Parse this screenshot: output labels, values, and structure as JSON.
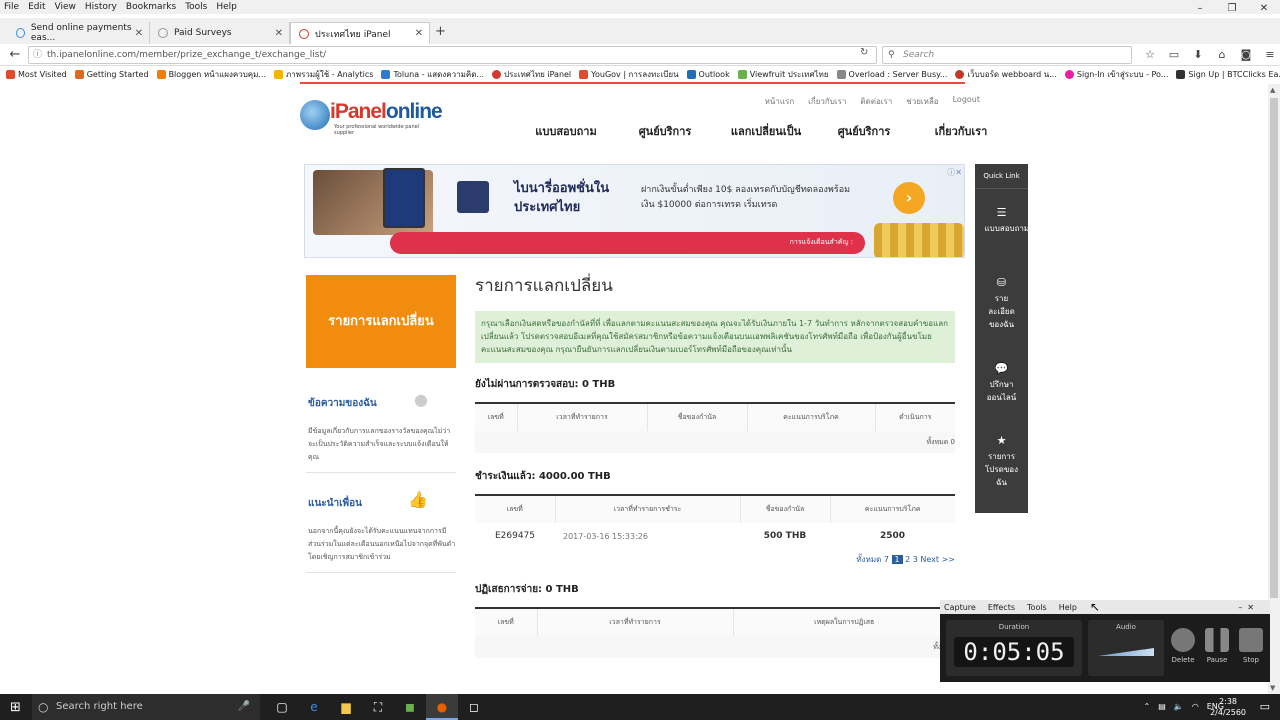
{
  "browser": {
    "menu": [
      "File",
      "Edit",
      "View",
      "History",
      "Bookmarks",
      "Tools",
      "Help"
    ],
    "tabs": [
      {
        "label": "Send online payments eas..."
      },
      {
        "label": "Paid Surveys"
      },
      {
        "label": "ประเทศไทย iPanel"
      }
    ],
    "url": "th.ipanelonline.com/member/prize_exchange_t/exchange_list/",
    "search_placeholder": "Search",
    "bookmarks": [
      "Most Visited",
      "Getting Started",
      "Bloggen หน้าแผงควบคุม...",
      "ภาพรวมผู้ใช้ - Analytics",
      "Toluna - แสดงความคิด...",
      "ประเทศไทย iPanel",
      "YouGov | การลงทะเบียน",
      "Outlook",
      "Viewfruit ประเทศไทย",
      "Overload : Server Busy...",
      "เว็บบอร์ด webboard น...",
      "Sign-In เข้าสู่ระบบ - Po...",
      "Sign Up | BTCClicks Ea..."
    ]
  },
  "site": {
    "logo_text_a": "iPanel",
    "logo_text_b": "online",
    "logo_tag": "Your professional worldwide panel supplier",
    "toplinks": [
      "หน้าแรก",
      "เกี่ยวกับเรา",
      "ติดต่อเรา",
      "ช่วยเหลือ",
      "Logout"
    ],
    "mainnav": [
      "แบบสอบถาม",
      "ศูนย์บริการ",
      "แลกเปลี่ยนเป็น",
      "ศูนย์บริการ",
      "เกี่ยวกับเรา"
    ]
  },
  "banner": {
    "headline": "ไบนารี่ออพชั่นใน ประเทศไทย",
    "sub": "ฝากเงินขั้นต่ำเพียง 10$ ลองเทรดกับบัญชีทดลองพร้อมเงิน $10000 ต่อการเทรด เริ่มเทรด",
    "redbar_text": "การแจ้งเตือนสำคัญ :"
  },
  "quicklink": {
    "title": "Quick Link",
    "items": [
      {
        "label": "แบบสอบถาม",
        "icon": "list-icon"
      },
      {
        "label": "รายละเอียดของฉัน",
        "icon": "database-icon"
      },
      {
        "label": "ปรึกษาออนไลน์",
        "icon": "chat-icon"
      },
      {
        "label": "รายการโปรดของฉัน",
        "icon": "star-icon"
      }
    ]
  },
  "sidebar": {
    "active": "รายการแลกเปลี่ยน",
    "messages_title": "ข้อความของฉัน",
    "messages_desc": "มีข้อมูลเกี่ยวกับการแลกของรางวัลของคุณไม่ว่าจะเป็นประวัติความสำเร็จและระบบแจ้งเตือนให้คุณ",
    "refer_title": "แนะนำเพื่อน",
    "refer_desc": "นอกจากนี้คุณยังจะได้รับคะแนนแทนจากการมีส่วนร่วมในแต่ละเดือนนอกเหนือไปจากจุดที่พันดำโดยเชิญการสมาชิกเข้าร่วม"
  },
  "content": {
    "title": "รายการแลกเปลี่ยน",
    "notice": "กรุณาเลือกเงินสดหรือของกำนัลที่ที่ เพื่อแลกตามคะแนนสะสมของคุณ คุณจะได้รับเงินภายใน 1-7 วันทำการ หลักจากตรวจสอบคำขอแลกเปลี่ยนแล้ว โปรดตรวจสอบอีเมลที่คุณใช้สมัครสมาชิกหรือข้อความแจ้งเตือนบนแอพพลิเคชันของโทรศัพท์มือถือ เพื่อป้องกันผู้อื่นขโมยคะแนนสะสมของคุณ กรุณายืนยันการแลกเปลี่ยนเงินตามเบอร์โทรศัพท์มือถือของคุณเท่านั้น",
    "pending": {
      "title": "ยังไม่ผ่านการตรวจสอบ: 0 THB",
      "headers": [
        "เลขที่",
        "เวลาที่ทำรายการ",
        "ชื่อของกำนัล",
        "คะแนนการบริโภค",
        "ดำเนินการ"
      ],
      "total": "ทั้งหมด 0"
    },
    "paid": {
      "title": "ชำระเงินแล้ว: 4000.00 THB",
      "headers": [
        "เลขที่",
        "เวลาที่ทำรายการชำระ",
        "ชื่อของกำนัล",
        "คะแนนการบริโภค"
      ],
      "rows": [
        [
          "E269475",
          "2017-03-16 15:33:26",
          "500 THB",
          "2500"
        ]
      ],
      "pager_total": "ทั้งหมด 7",
      "pager_current": "1",
      "pager_rest": "2 3 Next >>"
    },
    "rejected": {
      "title": "ปฏิเสธการจ่าย: 0 THB",
      "headers": [
        "เลขที่",
        "เวลาที่ทำรายการ",
        "เหตุผลในการปฏิเสธ"
      ],
      "total": "ทั้งหมด"
    }
  },
  "recorder": {
    "menu": [
      "Capture",
      "Effects",
      "Tools",
      "Help"
    ],
    "duration_label": "Duration",
    "duration": "0:05:05",
    "audio_label": "Audio",
    "buttons": [
      "Delete",
      "Pause",
      "Stop"
    ]
  },
  "taskbar": {
    "search": "Search right here",
    "lang": "ENG",
    "time": "2:38",
    "date": "2/4/2560"
  }
}
